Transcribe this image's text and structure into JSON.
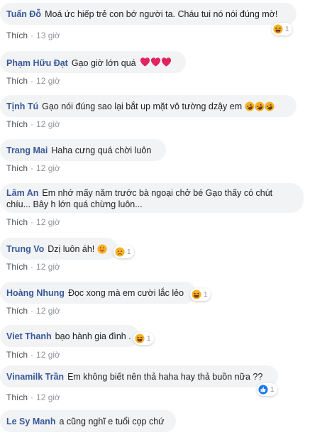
{
  "comments": [
    {
      "author": "Tuấn Đỗ",
      "text": "Moá ức hiếp trẻ con bớ người ta. Cháu tui nó nói đúng mờ!",
      "like_label": "Thích",
      "time": "13 giờ",
      "reactions": {
        "icon": "haha-icon",
        "count": "1"
      }
    },
    {
      "author": "Phạm Hữu Đạt",
      "text": "Gạo giờ lớn quá",
      "emoji": [
        "heart-icon",
        "heart-icon",
        "heart-icon"
      ],
      "like_label": "Thích",
      "time": "12 giờ"
    },
    {
      "author": "Tịnh Tú",
      "text": "Gạo nói đúng sao lại bắt up mặt vô tường dzậy em",
      "emoji": [
        "rofl-icon",
        "rofl-icon",
        "rofl-icon"
      ],
      "like_label": "Thích",
      "time": "12 giờ"
    },
    {
      "author": "Trang Mai",
      "text": "Haha cưng quá chời luôn",
      "like_label": "Thích",
      "time": "12 giờ"
    },
    {
      "author": "Lâm An",
      "text": "Em nhớ mấy năm trước bà ngoại chở bé Gạo thấy có chút",
      "text2": "chíu... Bây h lớn quá chừng luôn...",
      "like_label": "Thích",
      "time": "12 giờ"
    },
    {
      "author": "Trung Vo",
      "text": "Dzị luôn áh!",
      "emoji": [
        "tongue-out-icon"
      ],
      "like_label": "Thích",
      "time": "12 giờ",
      "reactions": {
        "icon": "sad-icon",
        "count": "1"
      }
    },
    {
      "author": "Hoàng Nhung",
      "text": "Đọc xong mà em cười lắc lẻo",
      "like_label": "Thích",
      "time": "12 giờ",
      "reactions": {
        "icon": "haha-icon",
        "count": "1"
      }
    },
    {
      "author": "Viet Thanh",
      "text": "bạo hành gia đình .",
      "like_label": "Thích",
      "time": "12 giờ",
      "reactions": {
        "icon": "haha-icon",
        "count": "1"
      }
    },
    {
      "author": "Vinamilk Trần",
      "text": "Em không biết nên thả haha hay thả buồn nữa ??",
      "like_label": "Thích",
      "time": "12 giờ",
      "reactions": {
        "icon": "like-icon",
        "count": "1"
      }
    },
    {
      "author": "Le Sy Manh",
      "text": "a cũng nghĩ e tuổi cọp chứ",
      "like_label": "Thích",
      "time": "12 giờ"
    }
  ],
  "colors": {
    "bubble": "#f2f3f5",
    "author": "#385898",
    "meta": "#90949c",
    "haha": "#f7b125",
    "heart": "#e0245e",
    "like": "#1877f2"
  }
}
